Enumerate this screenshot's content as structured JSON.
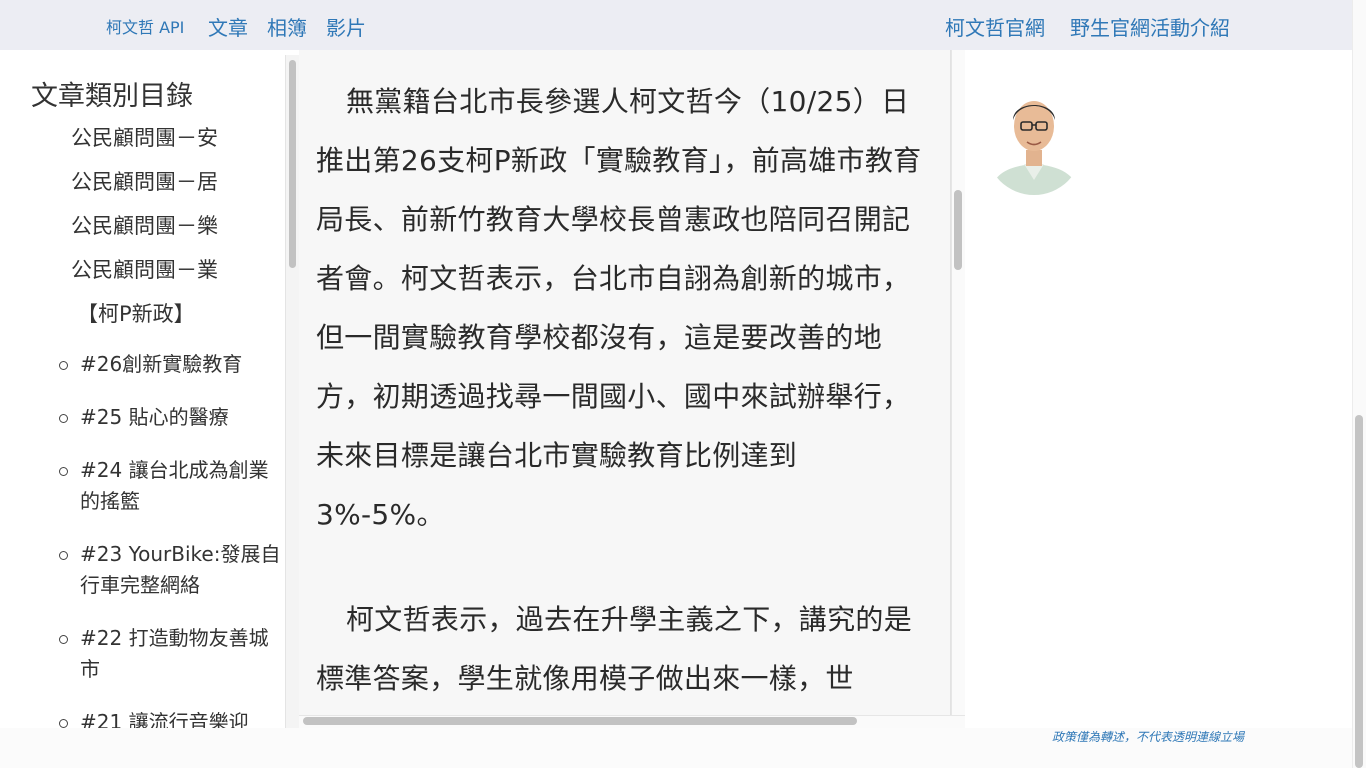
{
  "nav": {
    "api": "柯文哲 API",
    "articles": "文章",
    "albums": "相簿",
    "videos": "影片",
    "official_site": "柯文哲官網",
    "wild_site": "野生官網活動介紹"
  },
  "sidebar": {
    "title": "文章類別目錄",
    "categories": [
      "公民顧問團－安",
      "公民顧問團－居",
      "公民顧問團－樂",
      "公民顧問團－業"
    ],
    "new_policy": "【柯P新政】",
    "policies": [
      "#26創新實驗教育",
      "#25 貼心的醫療",
      "#24 讓台北成為創業的搖籃",
      "#23 YourBike:發展自行車完整網絡",
      "#22 打造動物友善城市",
      "#21 讓流行音樂迎"
    ]
  },
  "article": {
    "paragraph_1": "無黨籍台北市長參選人柯文哲今（10/25）日推出第26支柯P新政「實驗教育」，前高雄市教育局長、前新竹教育大學校長曾憲政也陪同召開記者會。柯文哲表示，台北市自詡為創新的城市，但一間實驗教育學校都沒有，這是要改善的地方，初期透過找尋一間國小、國中來試辦舉行，未來目標是讓台北市實驗教育比例達到3%-5%。",
    "paragraph_2": "柯文哲表示，過去在升學主義之下，講究的是標準答案，學生就像用模子做出來一樣，世"
  },
  "footer": {
    "disclaimer": "政策僅為轉述，不代表透明連線立場"
  },
  "colors": {
    "link": "#2f78b7",
    "nav_bg": "#ecedf3",
    "article_bg": "#f7f7f7"
  }
}
